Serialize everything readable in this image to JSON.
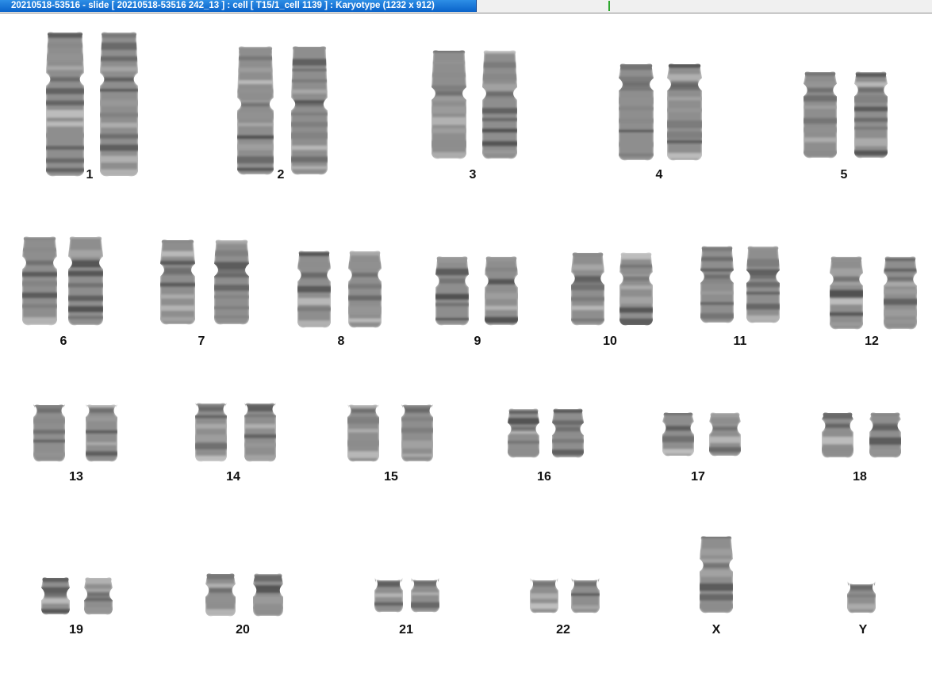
{
  "window": {
    "title": "20210518-53516 - slide [ 20210518-53516 242_13 ] : cell [ T15/1_cell 1139 ] : Karyotype  (1232 x 912)"
  },
  "karyotype": {
    "labels": {
      "c1": "1",
      "c2": "2",
      "c3": "3",
      "c4": "4",
      "c5": "5",
      "c6": "6",
      "c7": "7",
      "c8": "8",
      "c9": "9",
      "c10": "10",
      "c11": "11",
      "c12": "12",
      "c13": "13",
      "c14": "14",
      "c15": "15",
      "c16": "16",
      "c17": "17",
      "c18": "18",
      "c19": "19",
      "c20": "20",
      "c21": "21",
      "c22": "22",
      "cX": "X",
      "cY": "Y"
    }
  }
}
